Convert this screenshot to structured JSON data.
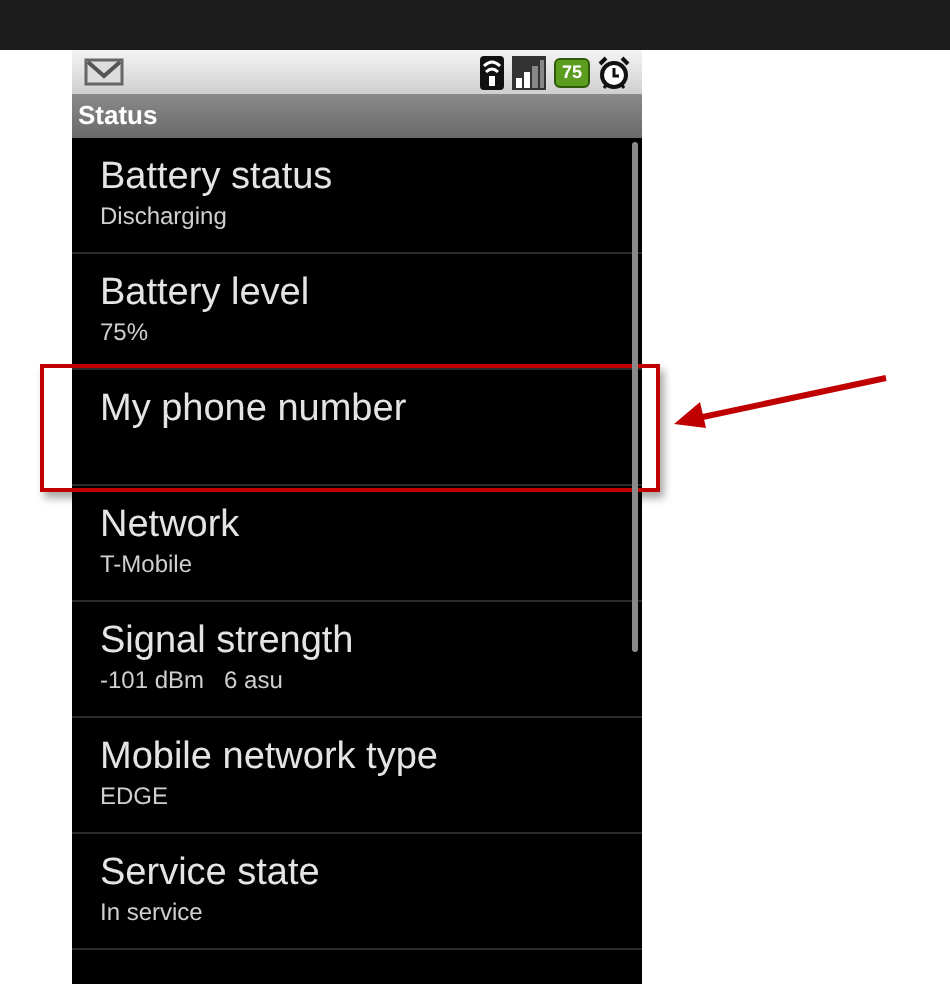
{
  "status_bar": {
    "battery": "75"
  },
  "title": "Status",
  "items": [
    {
      "title": "Battery status",
      "summary": "Discharging",
      "highlighted": false
    },
    {
      "title": "Battery level",
      "summary": "75%",
      "highlighted": false
    },
    {
      "title": "My phone number",
      "highlighted": true
    },
    {
      "title": "Network",
      "summary": "T-Mobile",
      "highlighted": false
    },
    {
      "title": "Signal strength",
      "summary": "-101 dBm   6 asu",
      "highlighted": false
    },
    {
      "title": "Mobile network type",
      "summary": "EDGE",
      "highlighted": false
    },
    {
      "title": "Service state",
      "summary": "In service",
      "highlighted": false
    }
  ]
}
